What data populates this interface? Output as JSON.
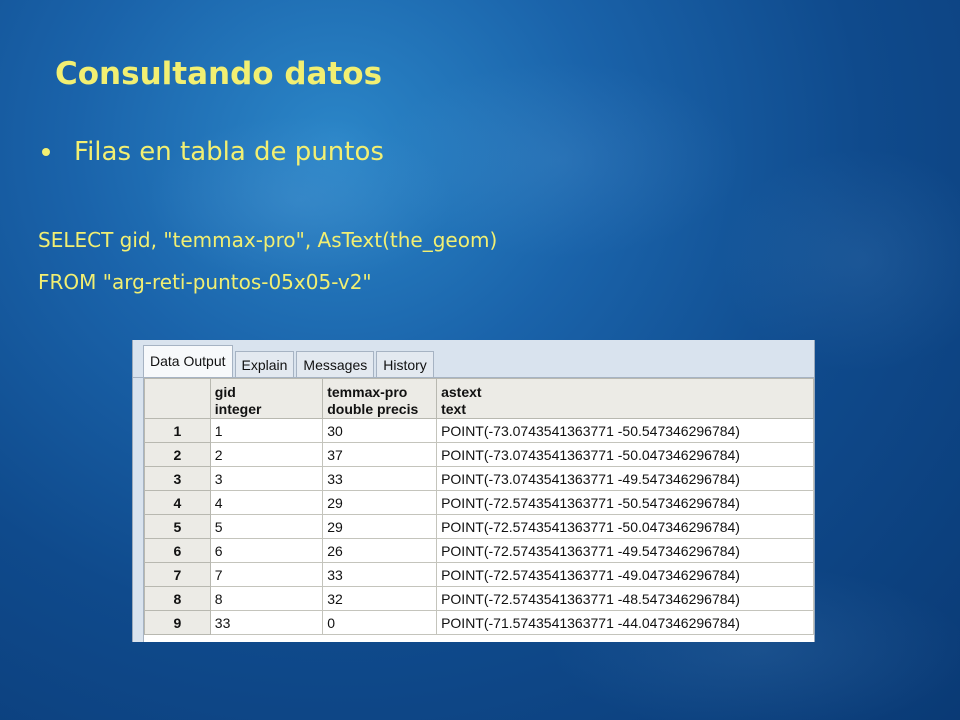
{
  "slide": {
    "title": "Consultando datos",
    "bullet": "Filas en tabla de puntos",
    "sql_line1": "SELECT gid, \"temmax-pro\", AsText(the_geom)",
    "sql_line2": "FROM \"arg-reti-puntos-05x05-v2\""
  },
  "tabs": [
    "Data Output",
    "Explain",
    "Messages",
    "History"
  ],
  "active_tab": "Data Output",
  "columns": [
    {
      "name": "gid",
      "type": "integer"
    },
    {
      "name": "temmax-pro",
      "type": "double precis"
    },
    {
      "name": "astext",
      "type": "text"
    }
  ],
  "rows": [
    {
      "num": "1",
      "gid": "1",
      "temmax": "30",
      "astext": "POINT(-73.0743541363771 -50.547346296784)"
    },
    {
      "num": "2",
      "gid": "2",
      "temmax": "37",
      "astext": "POINT(-73.0743541363771 -50.047346296784)"
    },
    {
      "num": "3",
      "gid": "3",
      "temmax": "33",
      "astext": "POINT(-73.0743541363771 -49.547346296784)"
    },
    {
      "num": "4",
      "gid": "4",
      "temmax": "29",
      "astext": "POINT(-72.5743541363771 -50.547346296784)"
    },
    {
      "num": "5",
      "gid": "5",
      "temmax": "29",
      "astext": "POINT(-72.5743541363771 -50.047346296784)"
    },
    {
      "num": "6",
      "gid": "6",
      "temmax": "26",
      "astext": "POINT(-72.5743541363771 -49.547346296784)"
    },
    {
      "num": "7",
      "gid": "7",
      "temmax": "33",
      "astext": "POINT(-72.5743541363771 -49.047346296784)"
    },
    {
      "num": "8",
      "gid": "8",
      "temmax": "32",
      "astext": "POINT(-72.5743541363771 -48.547346296784)"
    },
    {
      "num": "9",
      "gid": "33",
      "temmax": "0",
      "astext": "POINT(-71.5743541363771 -44.047346296784)"
    }
  ],
  "colors": {
    "title_text": "#f2ef72",
    "background": "#1a63aa",
    "grid_header": "#ecebe6"
  }
}
